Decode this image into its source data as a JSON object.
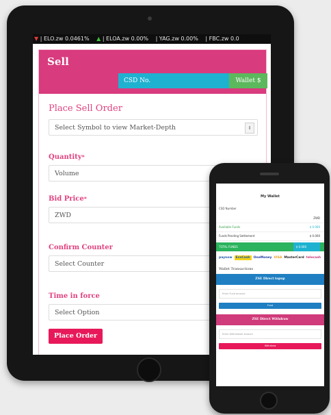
{
  "tablet": {
    "ticker": [
      {
        "arrow": "▼",
        "dir": "down",
        "text": "| ELO.zw 0.0461%"
      },
      {
        "arrow": "▲",
        "dir": "up",
        "text": "| ELOA.zw 0.00%"
      },
      {
        "arrow": "",
        "dir": "none",
        "text": "| YAG.zw 0.00%"
      },
      {
        "arrow": "",
        "dir": "none",
        "text": "| FBC.zw 0.0"
      }
    ],
    "header": {
      "title": "Sell",
      "csd_label": "CSD No.",
      "wallet_label": "Wallet $"
    },
    "form": {
      "heading": "Place Sell Order",
      "symbol_select": "Select Symbol to view Market-Depth",
      "quantity_label": "Quantity",
      "quantity_placeholder": "Volume",
      "bid_price_label": "Bid Price",
      "bid_price_value": "ZWD",
      "required_mark": "*",
      "confirm_counter_label": "Confirm Counter",
      "confirm_counter_select": "Select Counter",
      "time_in_force_label": "Time in force",
      "time_in_force_select": "Select Option",
      "place_order_button": "Place Order"
    }
  },
  "phone": {
    "title": "My Wallet",
    "csd_number_label": "CSD Number",
    "rows": [
      {
        "label": "",
        "value": "ZWD"
      },
      {
        "label": "Available Funds",
        "value": "$ 0.000"
      },
      {
        "label": "Funds Pending Settlement",
        "value": "$ 0.000"
      }
    ],
    "total_label": "TOTAL FUNDS",
    "total_value": "$ 0.000",
    "logos": [
      "paynow",
      "EcoCash",
      "OneMoney",
      "VISA",
      "MasterCard",
      "telecash"
    ],
    "transactions_heading": "Wallet Transactions",
    "topup": {
      "heading": "ZSE Direct topup",
      "placeholder": "Enter Fund amount",
      "button": "Fund"
    },
    "withdraw": {
      "heading": "ZSE Direct Withdraw",
      "placeholder": "Enter Withdrawal amount",
      "button": "Withdraw"
    }
  },
  "colors": {
    "accent_pink": "#d83b7e",
    "label_pink": "#e0417f",
    "csd_blue": "#1fb2d0",
    "wallet_green": "#5cb85c",
    "order_red": "#e8195a"
  }
}
